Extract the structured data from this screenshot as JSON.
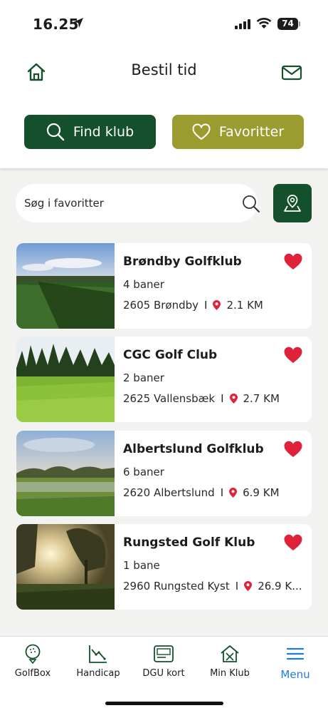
{
  "status": {
    "time": "16.25",
    "battery": "74"
  },
  "header": {
    "title": "Bestil tid",
    "home_icon": "home-icon",
    "mail_icon": "mail-icon"
  },
  "actions": {
    "find_label": "Find klub",
    "favorites_label": "Favoritter"
  },
  "search": {
    "placeholder": "Søg i favoritter"
  },
  "clubs": [
    {
      "name": "Brøndby Golfklub",
      "courses": "4 baner",
      "location": "2605 Brøndby",
      "distance": "2.1 KM",
      "favorite": true
    },
    {
      "name": "CGC Golf Club",
      "courses": "2 baner",
      "location": "2625 Vallensbæk",
      "distance": "2.7 KM",
      "favorite": true
    },
    {
      "name": "Albertslund Golfklub",
      "courses": "6 baner",
      "location": "2620 Albertslund",
      "distance": "6.9 KM",
      "favorite": true
    },
    {
      "name": "Rungsted Golf Klub",
      "courses": "1 bane",
      "location": "2960 Rungsted Kyst",
      "distance": "26.9 K...",
      "favorite": true
    }
  ],
  "separator": "I",
  "nav": [
    {
      "label": "GolfBox",
      "icon": "golf-ball-icon"
    },
    {
      "label": "Handicap",
      "icon": "handicap-chart-icon"
    },
    {
      "label": "DGU kort",
      "icon": "card-icon"
    },
    {
      "label": "Min Klub",
      "icon": "club-house-icon"
    },
    {
      "label": "Menu",
      "icon": "menu-icon",
      "active": true
    }
  ],
  "colors": {
    "primary_green": "#14502c",
    "favorites_olive": "#9a9c2f",
    "heart_red": "#e0213a",
    "active_blue": "#1e7be6"
  }
}
